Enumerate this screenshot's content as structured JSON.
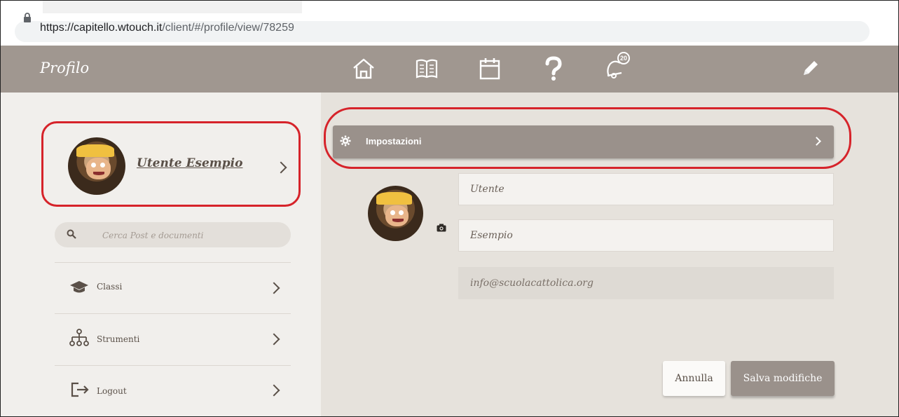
{
  "browser": {
    "url_host": "https://capitello.wtouch.it",
    "url_path": "/client/#/profile/view/78259"
  },
  "header": {
    "title": "Profilo",
    "icons": [
      "home-icon",
      "book-icon",
      "calendar-icon",
      "help-icon",
      "notifications-icon",
      "edit-icon"
    ],
    "notification_count": "20"
  },
  "sidebar": {
    "user_name": "Utente Esempio",
    "search_placeholder": "Cerca Post e documenti",
    "items": [
      {
        "label": "Classi",
        "icon": "graduation-cap-icon"
      },
      {
        "label": "Strumenti",
        "icon": "org-chart-icon"
      },
      {
        "label": "Logout",
        "icon": "logout-icon"
      }
    ]
  },
  "main": {
    "settings_label": "Impostazioni",
    "first_name": "Utente",
    "last_name": "Esempio",
    "email": "info@scuolacattolica.org",
    "cancel_label": "Annulla",
    "save_label": "Salva modifiche"
  },
  "colors": {
    "header_bg": "#a09790",
    "sidebar_bg": "#f1efec",
    "content_bg": "#e6e2dc",
    "highlight": "#d6232a",
    "text": "#5a5048"
  }
}
